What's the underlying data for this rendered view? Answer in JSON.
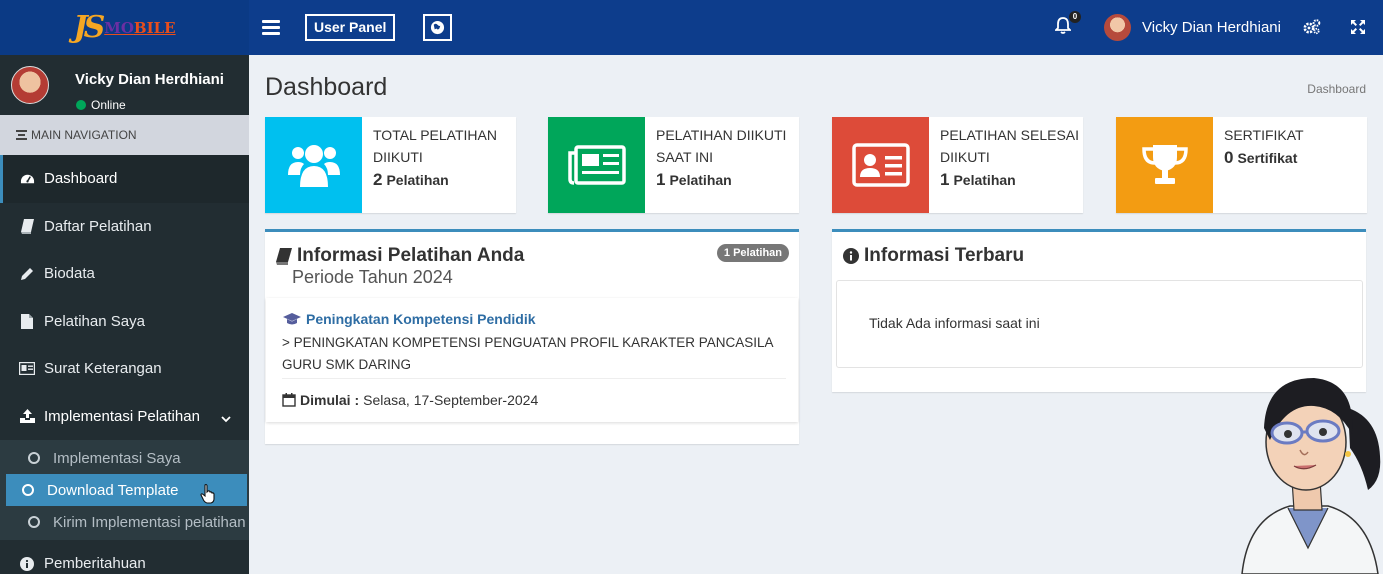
{
  "colors": {
    "header": "#0d3d8c",
    "sidebar": "#222d32",
    "accent": "#3c8dbc",
    "cyan": "#00c0ef",
    "green": "#00a65a",
    "red": "#dd4b39",
    "orange": "#f39c12"
  },
  "logo": {
    "js": "JS",
    "mobile_prefix": "MO",
    "mobile_suffix": "BILE"
  },
  "header": {
    "user_panel_label": "User Panel",
    "notif_count": "0",
    "user_name": "Vicky Dian Herdhiani"
  },
  "sidebar": {
    "user_name": "Vicky Dian Herdhiani",
    "status": "Online",
    "nav_header": "MAIN NAVIGATION",
    "items": [
      {
        "label": "Dashboard",
        "icon": "dashboard-icon"
      },
      {
        "label": "Daftar Pelatihan",
        "icon": "book-icon"
      },
      {
        "label": "Biodata",
        "icon": "pencil-icon"
      },
      {
        "label": "Pelatihan Saya",
        "icon": "file-icon"
      },
      {
        "label": "Surat Keterangan",
        "icon": "id-card-icon"
      },
      {
        "label": "Implementasi Pelatihan",
        "icon": "upload-icon"
      },
      {
        "label": "Pemberitahuan",
        "icon": "info-icon"
      }
    ],
    "sub_items": [
      {
        "label": "Implementasi Saya"
      },
      {
        "label": "Download Template"
      },
      {
        "label": "Kirim Implementasi pelatihan"
      }
    ]
  },
  "page": {
    "title": "Dashboard",
    "breadcrumb": "Dashboard"
  },
  "info_boxes": [
    {
      "label": "TOTAL PELATIHAN DIIKUTI",
      "value": "2",
      "unit": "Pelatihan"
    },
    {
      "label": "PELATIHAN DIIKUTI SAAT INI",
      "value": "1",
      "unit": "Pelatihan"
    },
    {
      "label": "PELATIHAN SELESAI DIIKUTI",
      "value": "1",
      "unit": "Pelatihan"
    },
    {
      "label": "SERTIFIKAT",
      "value": "0",
      "unit": "Sertifikat"
    }
  ],
  "training_box": {
    "title": "Informasi Pelatihan Anda",
    "subtitle": "Periode Tahun 2024",
    "badge": "1 Pelatihan",
    "course_title": "Peningkatan Kompetensi Pendidik",
    "course_desc": "> PENINGKATAN KOMPETENSI PENGUATAN PROFIL KARAKTER PANCASILA GURU SMK DARING",
    "date_label": "Dimulai :",
    "date_value": "Selasa, 17-September-2024"
  },
  "news_box": {
    "title": "Informasi Terbaru",
    "empty_text": "Tidak Ada informasi saat ini"
  }
}
